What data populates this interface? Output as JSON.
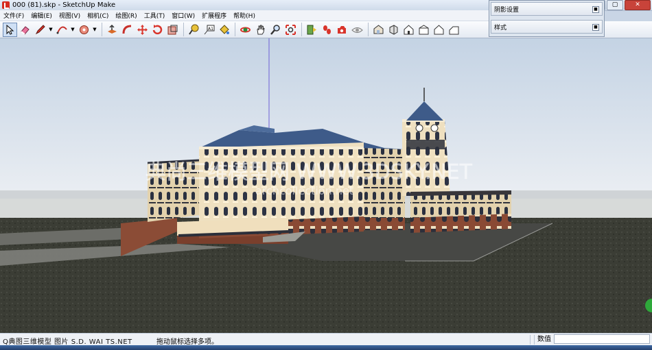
{
  "window": {
    "title": "000 (81).skp - SketchUp Make",
    "buttons": [
      "–",
      "▢",
      "✕"
    ]
  },
  "menu": [
    "文件(F)",
    "编辑(E)",
    "视图(V)",
    "相机(C)",
    "绘图(R)",
    "工具(T)",
    "窗口(W)",
    "扩展程序",
    "帮助(H)"
  ],
  "trays": {
    "shadow": "阴影设置",
    "styles": "样式"
  },
  "toolbar": {
    "tools": [
      "select",
      "eraser",
      "pencil",
      "arc",
      "shapes",
      "push-pull",
      "follow-me",
      "move",
      "rotate",
      "scale",
      "tape-measure",
      "text",
      "paint-bucket",
      "orbit",
      "pan",
      "zoom",
      "zoom-extents",
      "section",
      "walk",
      "position-camera",
      "look-around",
      "iso-view",
      "top-view",
      "front-view",
      "right-view",
      "back-view",
      "left-view"
    ]
  },
  "status": {
    "overlay_text": "Q典图三维模型 图片 S.D. WAI TS.NET",
    "help_text": "拖动鼠标选择多项。",
    "measurements_label": "数值",
    "measurements_value": ""
  },
  "watermark": {
    "main": "典尚三维模型网 WWW.3DSKY.NET",
    "sub": "archcollection.net"
  }
}
